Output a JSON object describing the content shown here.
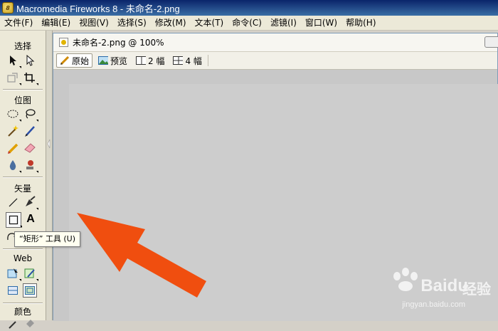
{
  "window": {
    "title": "Macromedia Fireworks 8 - 未命名-2.png",
    "app_icon_letter": "8"
  },
  "menu": [
    {
      "label": "文件(F)"
    },
    {
      "label": "编辑(E)"
    },
    {
      "label": "视图(V)"
    },
    {
      "label": "选择(S)"
    },
    {
      "label": "修改(M)"
    },
    {
      "label": "文本(T)"
    },
    {
      "label": "命令(C)"
    },
    {
      "label": "滤镜(I)"
    },
    {
      "label": "窗口(W)"
    },
    {
      "label": "帮助(H)"
    }
  ],
  "tools": {
    "sections": {
      "select": "选择",
      "bitmap": "位图",
      "vector": "矢量",
      "web": "Web",
      "colors": "颜色"
    },
    "text_tool_glyph": "A",
    "tooltip": "“矩形” 工具 (U)"
  },
  "document": {
    "title": "未命名-2.png @ 100%",
    "tabs": [
      {
        "label": "原始",
        "icon": "pencil-icon",
        "active": true
      },
      {
        "label": "预览",
        "icon": "image-preview-icon",
        "active": false
      },
      {
        "label": "2 幅",
        "icon": "two-up-icon",
        "active": false
      },
      {
        "label": "4 幅",
        "icon": "four-up-icon",
        "active": false
      }
    ]
  },
  "watermark": {
    "main": "Baidu",
    "jingyan": "经验",
    "sub": "jingyan.baidu.com"
  },
  "colors": {
    "annotation_arrow": "#f04e0f",
    "title_bar": "#0a246a",
    "canvas": "#cdcdcd"
  }
}
